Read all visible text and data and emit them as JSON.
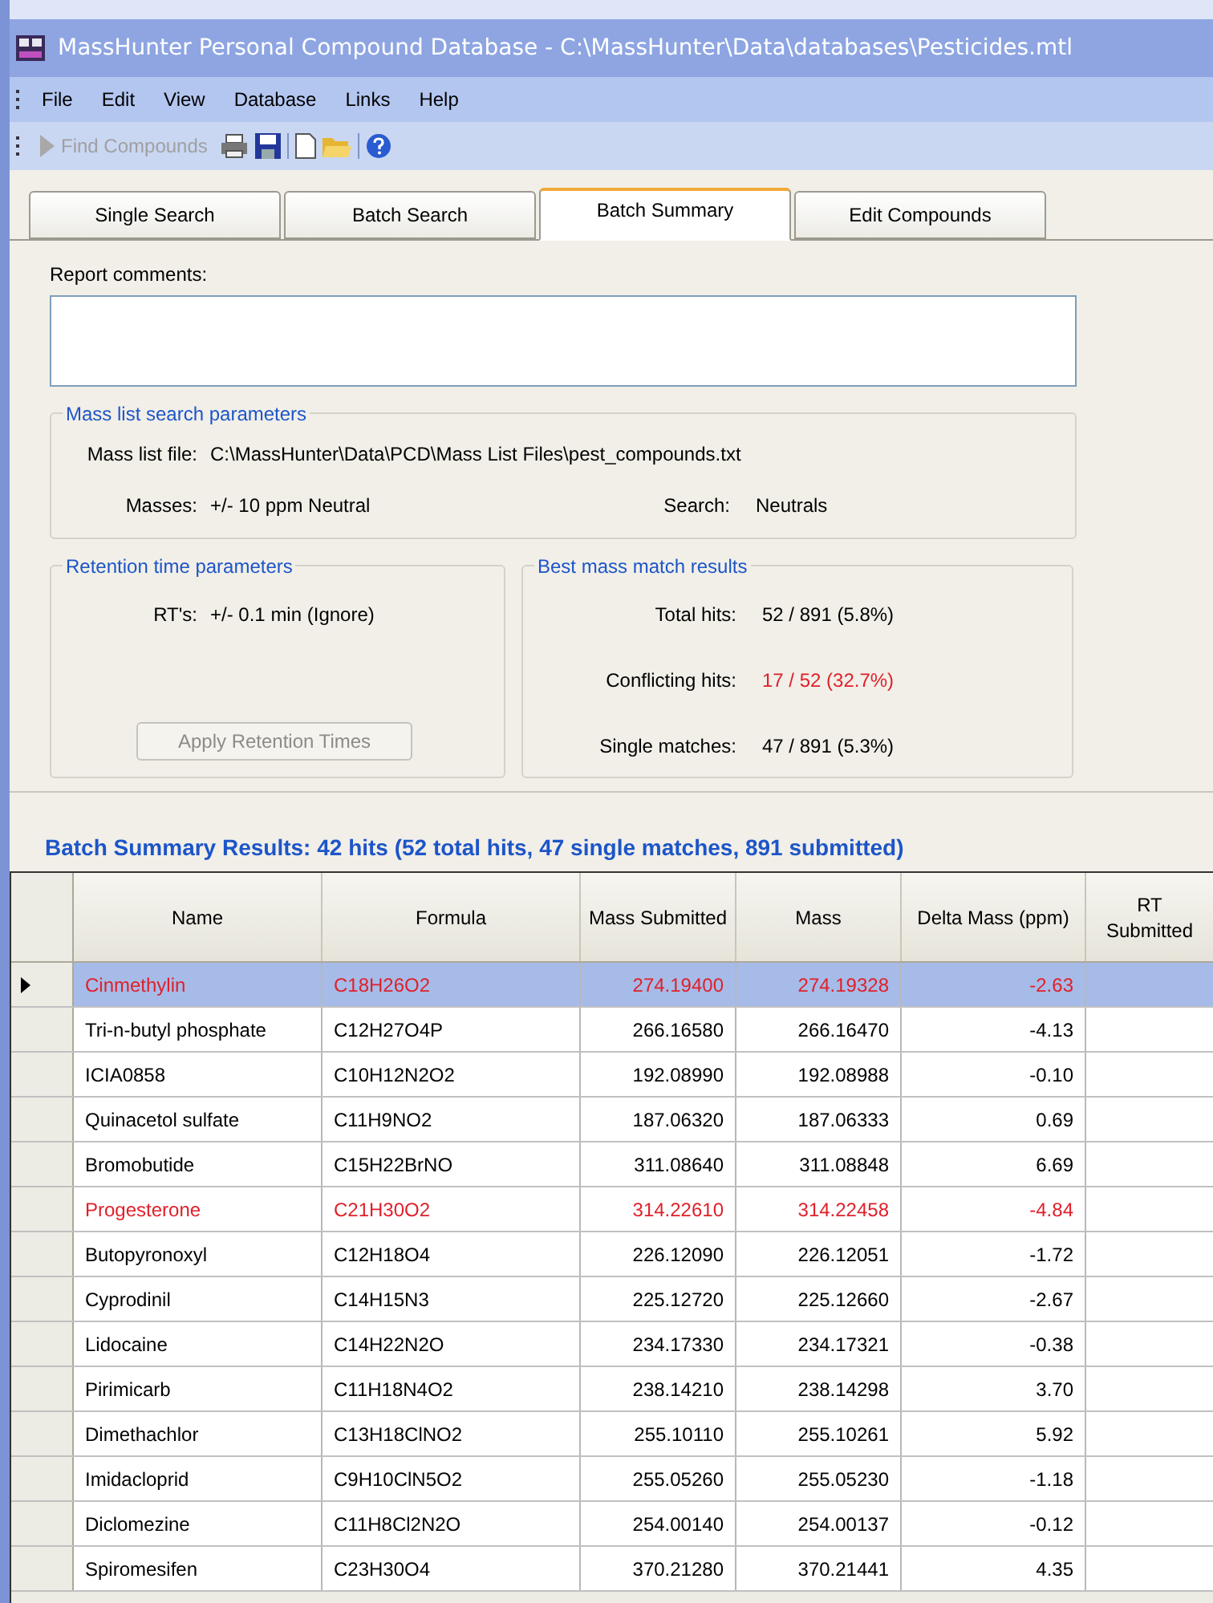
{
  "window": {
    "title": "MassHunter Personal Compound Database - C:\\MassHunter\\Data\\databases\\Pesticides.mtl"
  },
  "menu": [
    "File",
    "Edit",
    "View",
    "Database",
    "Links",
    "Help"
  ],
  "toolbar": {
    "find_label": "Find Compounds",
    "find_disabled": true
  },
  "tabs": [
    {
      "label": "Single Search",
      "selected": false
    },
    {
      "label": "Batch Search",
      "selected": false
    },
    {
      "label": "Batch Summary",
      "selected": true
    },
    {
      "label": "Edit Compounds",
      "selected": false
    }
  ],
  "report_comments": {
    "label": "Report comments:"
  },
  "mass_list": {
    "title": "Mass list search parameters",
    "file_label": "Mass list file:",
    "file_value": "C:\\MassHunter\\Data\\PCD\\Mass List Files\\pest_compounds.txt",
    "masses_label": "Masses:",
    "masses_value": "+/- 10 ppm Neutral",
    "search_label": "Search:",
    "search_value": "Neutrals"
  },
  "retention": {
    "title": "Retention time parameters",
    "rt_label": "RT's:",
    "rt_value": "+/- 0.1 min (Ignore)",
    "button": "Apply Retention Times",
    "button_disabled": true
  },
  "best_match": {
    "title": "Best mass match results",
    "rows": [
      {
        "label": "Total hits:",
        "value": "52 / 891 (5.8%)",
        "warning": false
      },
      {
        "label": "Conflicting hits:",
        "value": "17 / 52 (32.7%)",
        "warning": true
      },
      {
        "label": "Single matches:",
        "value": "47 / 891 (5.3%)",
        "warning": false
      }
    ]
  },
  "results_heading": "Batch Summary Results:  42 hits (52 total hits, 47 single matches, 891 submitted)",
  "table": {
    "columns": [
      "Name",
      "Formula",
      "Mass Submitted",
      "Mass",
      "Delta Mass (ppm)",
      "RT Submitted"
    ],
    "rows": [
      {
        "name": "Cinmethylin",
        "formula": "C18H26O2",
        "mass_submitted": "274.19400",
        "mass": "274.19328",
        "delta": "-2.63",
        "selected": true,
        "conflicting": true
      },
      {
        "name": "Tri-n-butyl phosphate",
        "formula": "C12H27O4P",
        "mass_submitted": "266.16580",
        "mass": "266.16470",
        "delta": "-4.13",
        "selected": false,
        "conflicting": false
      },
      {
        "name": "ICIA0858",
        "formula": "C10H12N2O2",
        "mass_submitted": "192.08990",
        "mass": "192.08988",
        "delta": "-0.10",
        "selected": false,
        "conflicting": false
      },
      {
        "name": "Quinacetol sulfate",
        "formula": "C11H9NO2",
        "mass_submitted": "187.06320",
        "mass": "187.06333",
        "delta": "0.69",
        "selected": false,
        "conflicting": false
      },
      {
        "name": "Bromobutide",
        "formula": "C15H22BrNO",
        "mass_submitted": "311.08640",
        "mass": "311.08848",
        "delta": "6.69",
        "selected": false,
        "conflicting": false
      },
      {
        "name": "Progesterone",
        "formula": "C21H30O2",
        "mass_submitted": "314.22610",
        "mass": "314.22458",
        "delta": "-4.84",
        "selected": false,
        "conflicting": true
      },
      {
        "name": "Butopyronoxyl",
        "formula": "C12H18O4",
        "mass_submitted": "226.12090",
        "mass": "226.12051",
        "delta": "-1.72",
        "selected": false,
        "conflicting": false
      },
      {
        "name": "Cyprodinil",
        "formula": "C14H15N3",
        "mass_submitted": "225.12720",
        "mass": "225.12660",
        "delta": "-2.67",
        "selected": false,
        "conflicting": false
      },
      {
        "name": "Lidocaine",
        "formula": "C14H22N2O",
        "mass_submitted": "234.17330",
        "mass": "234.17321",
        "delta": "-0.38",
        "selected": false,
        "conflicting": false
      },
      {
        "name": "Pirimicarb",
        "formula": "C11H18N4O2",
        "mass_submitted": "238.14210",
        "mass": "238.14298",
        "delta": "3.70",
        "selected": false,
        "conflicting": false
      },
      {
        "name": "Dimethachlor",
        "formula": "C13H18ClNO2",
        "mass_submitted": "255.10110",
        "mass": "255.10261",
        "delta": "5.92",
        "selected": false,
        "conflicting": false
      },
      {
        "name": "Imidacloprid",
        "formula": "C9H10ClN5O2",
        "mass_submitted": "255.05260",
        "mass": "255.05230",
        "delta": "-1.18",
        "selected": false,
        "conflicting": false
      },
      {
        "name": "Diclomezine",
        "formula": "C11H8Cl2N2O",
        "mass_submitted": "254.00140",
        "mass": "254.00137",
        "delta": "-0.12",
        "selected": false,
        "conflicting": false
      },
      {
        "name": "Spiromesifen",
        "formula": "C23H30O4",
        "mass_submitted": "370.21280",
        "mass": "370.21441",
        "delta": "4.35",
        "selected": false,
        "conflicting": false
      }
    ]
  }
}
